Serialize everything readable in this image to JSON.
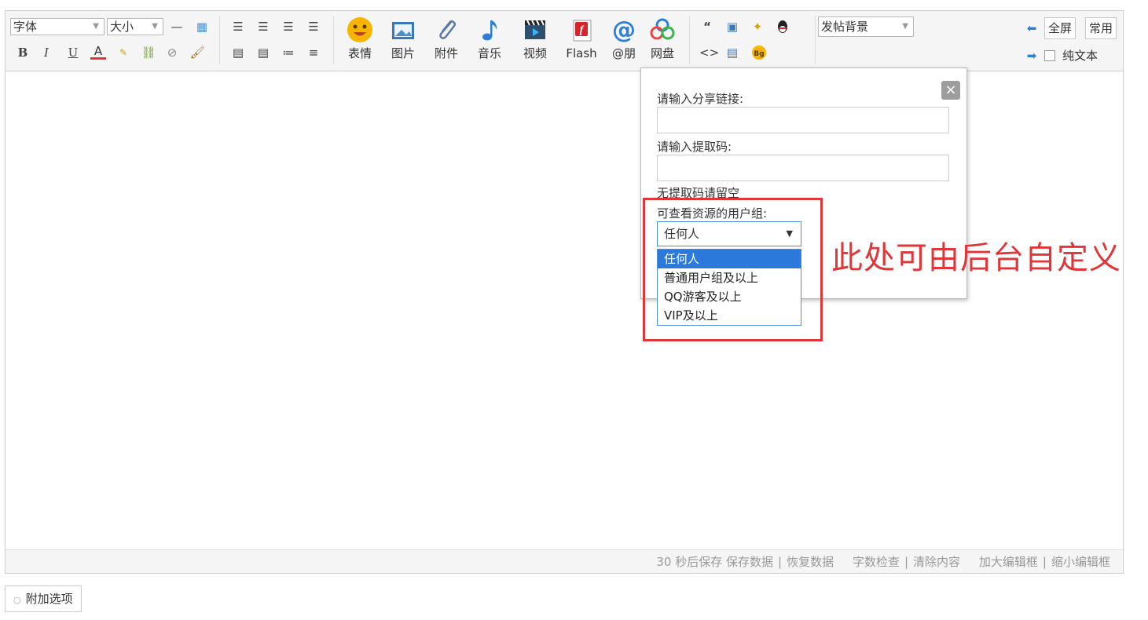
{
  "toolbar": {
    "font_select": "字体",
    "size_select": "大小",
    "background_select": "发帖背景",
    "big_buttons": [
      {
        "label": "表情",
        "icon": "smiley-icon"
      },
      {
        "label": "图片",
        "icon": "image-icon"
      },
      {
        "label": "附件",
        "icon": "paperclip-icon"
      },
      {
        "label": "音乐",
        "icon": "music-note-icon"
      },
      {
        "label": "视频",
        "icon": "video-clapper-icon"
      },
      {
        "label": "Flash",
        "icon": "flash-icon"
      },
      {
        "label": "@朋",
        "icon": "at-icon"
      },
      {
        "label": "网盘",
        "icon": "cloud-disk-icon"
      }
    ],
    "fullscreen_label": "全屏",
    "common_label": "常用",
    "plaintext_label": "纯文本"
  },
  "popup": {
    "share_link_label": "请输入分享链接:",
    "share_link_value": "",
    "code_label": "请输入提取码:",
    "code_value": "",
    "code_hint": "无提取码请留空",
    "group_label": "可查看资源的用户组:",
    "group_selected": "任何人",
    "group_options": [
      "任何人",
      "普通用户组及以上",
      "QQ游客及以上",
      "VIP及以上"
    ]
  },
  "annotation": "此处可由后台自定义",
  "footer": {
    "autosave": "30 秒后保存",
    "save_data": "保存数据",
    "restore_data": "恢复数据",
    "word_check": "字数检查",
    "clear_content": "清除内容",
    "enlarge": "加大编辑框",
    "shrink": "缩小编辑框"
  },
  "extra_options": "附加选项",
  "colors": {
    "accent_red": "#e0363a",
    "select_blue": "#2b79db"
  }
}
